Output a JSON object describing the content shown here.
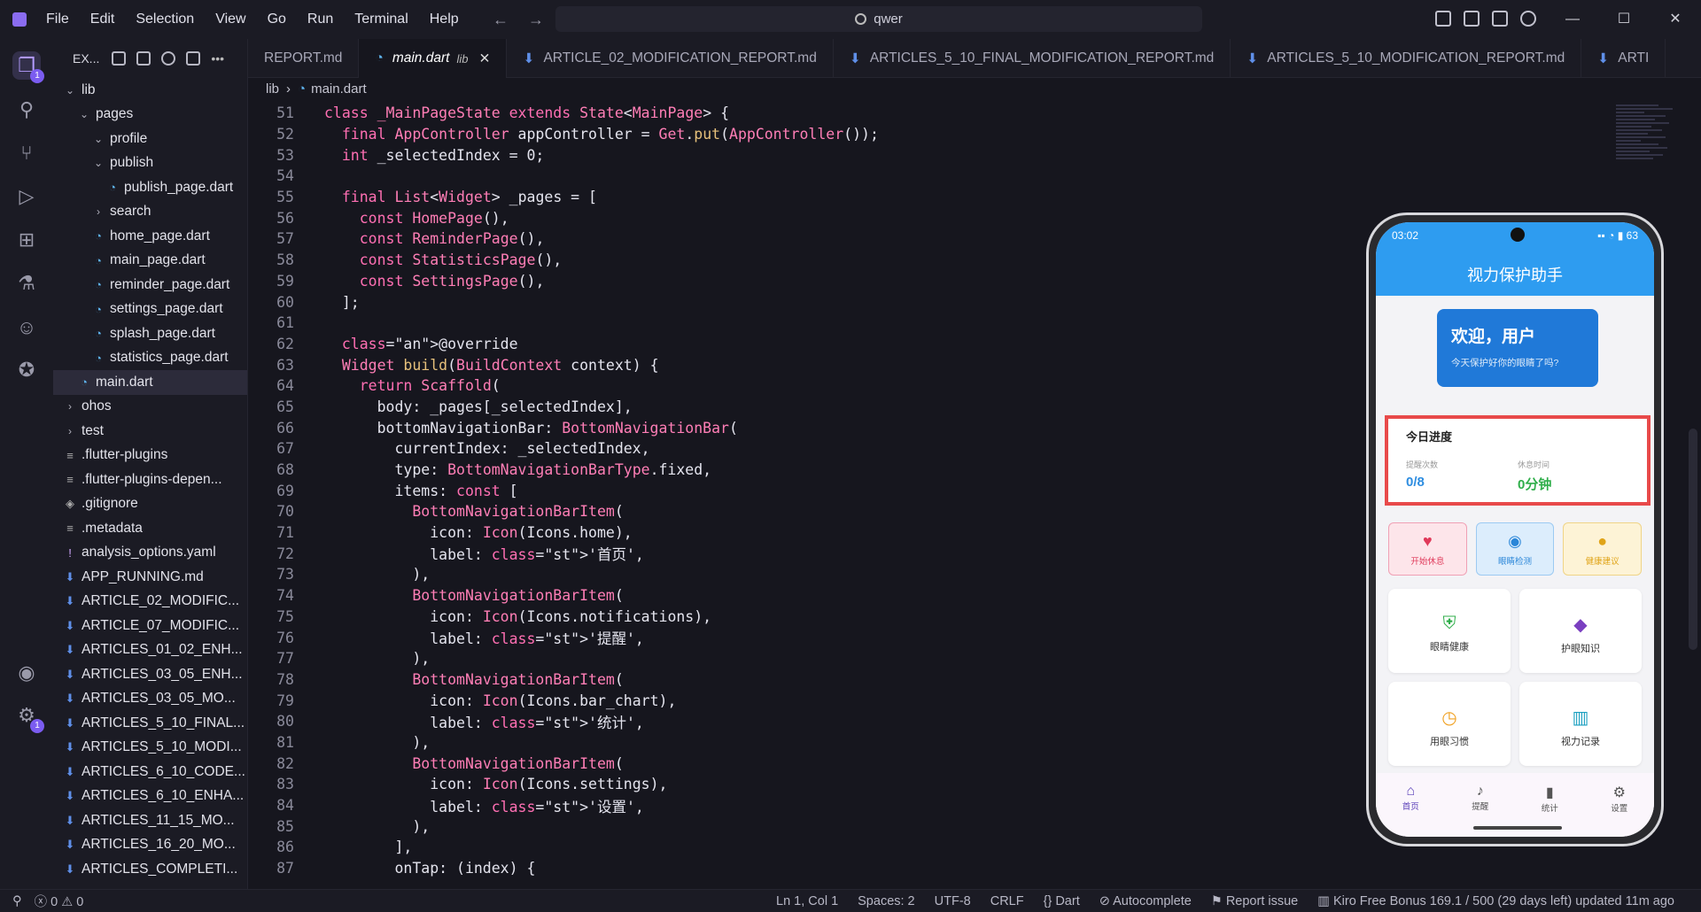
{
  "menu": [
    "File",
    "Edit",
    "Selection",
    "View",
    "Go",
    "Run",
    "Terminal",
    "Help"
  ],
  "search": {
    "text": "qwer"
  },
  "sidebar": {
    "title": "EX...",
    "items": [
      {
        "label": "lib",
        "indent": 1,
        "kind": "folder-open"
      },
      {
        "label": "pages",
        "indent": 2,
        "kind": "folder-open"
      },
      {
        "label": "profile",
        "indent": 3,
        "kind": "folder-open"
      },
      {
        "label": "publish",
        "indent": 3,
        "kind": "folder-open"
      },
      {
        "label": "publish_page.dart",
        "indent": 4,
        "kind": "dart"
      },
      {
        "label": "search",
        "indent": 3,
        "kind": "folder"
      },
      {
        "label": "home_page.dart",
        "indent": 3,
        "kind": "dart"
      },
      {
        "label": "main_page.dart",
        "indent": 3,
        "kind": "dart"
      },
      {
        "label": "reminder_page.dart",
        "indent": 3,
        "kind": "dart"
      },
      {
        "label": "settings_page.dart",
        "indent": 3,
        "kind": "dart"
      },
      {
        "label": "splash_page.dart",
        "indent": 3,
        "kind": "dart"
      },
      {
        "label": "statistics_page.dart",
        "indent": 3,
        "kind": "dart"
      },
      {
        "label": "main.dart",
        "indent": 2,
        "kind": "dart",
        "selected": true
      },
      {
        "label": "ohos",
        "indent": 1,
        "kind": "folder"
      },
      {
        "label": "test",
        "indent": 1,
        "kind": "folder"
      },
      {
        "label": ".flutter-plugins",
        "indent": 1,
        "kind": "gen"
      },
      {
        "label": ".flutter-plugins-depen...",
        "indent": 1,
        "kind": "gen"
      },
      {
        "label": ".gitignore",
        "indent": 1,
        "kind": "git"
      },
      {
        "label": ".metadata",
        "indent": 1,
        "kind": "gen"
      },
      {
        "label": "analysis_options.yaml",
        "indent": 1,
        "kind": "yaml"
      },
      {
        "label": "APP_RUNNING.md",
        "indent": 1,
        "kind": "md"
      },
      {
        "label": "ARTICLE_02_MODIFIC...",
        "indent": 1,
        "kind": "md"
      },
      {
        "label": "ARTICLE_07_MODIFIC...",
        "indent": 1,
        "kind": "md"
      },
      {
        "label": "ARTICLES_01_02_ENH...",
        "indent": 1,
        "kind": "md"
      },
      {
        "label": "ARTICLES_03_05_ENH...",
        "indent": 1,
        "kind": "md"
      },
      {
        "label": "ARTICLES_03_05_MO...",
        "indent": 1,
        "kind": "md"
      },
      {
        "label": "ARTICLES_5_10_FINAL...",
        "indent": 1,
        "kind": "md"
      },
      {
        "label": "ARTICLES_5_10_MODI...",
        "indent": 1,
        "kind": "md"
      },
      {
        "label": "ARTICLES_6_10_CODE...",
        "indent": 1,
        "kind": "md"
      },
      {
        "label": "ARTICLES_6_10_ENHA...",
        "indent": 1,
        "kind": "md"
      },
      {
        "label": "ARTICLES_11_15_MO...",
        "indent": 1,
        "kind": "md"
      },
      {
        "label": "ARTICLES_16_20_MO...",
        "indent": 1,
        "kind": "md"
      },
      {
        "label": "ARTICLES_COMPLETI...",
        "indent": 1,
        "kind": "md"
      }
    ]
  },
  "tabs": [
    {
      "label": "REPORT.md",
      "icon": "",
      "active": false
    },
    {
      "label": "main.dart",
      "suffix": "lib",
      "icon": "dart",
      "active": true
    },
    {
      "label": "ARTICLE_02_MODIFICATION_REPORT.md",
      "icon": "md",
      "active": false
    },
    {
      "label": "ARTICLES_5_10_FINAL_MODIFICATION_REPORT.md",
      "icon": "md",
      "active": false
    },
    {
      "label": "ARTICLES_5_10_MODIFICATION_REPORT.md",
      "icon": "md",
      "active": false
    },
    {
      "label": "ARTI",
      "icon": "md",
      "active": false
    }
  ],
  "breadcrumb": [
    "lib",
    "main.dart"
  ],
  "code_lines": [
    {
      "n": 51,
      "t": "class _MainPageState extends State<MainPage> {"
    },
    {
      "n": 52,
      "t": "  final AppController appController = Get.put(AppController());"
    },
    {
      "n": 53,
      "t": "  int _selectedIndex = 0;"
    },
    {
      "n": 54,
      "t": ""
    },
    {
      "n": 55,
      "t": "  final List<Widget> _pages = ["
    },
    {
      "n": 56,
      "t": "    const HomePage(),"
    },
    {
      "n": 57,
      "t": "    const ReminderPage(),"
    },
    {
      "n": 58,
      "t": "    const StatisticsPage(),"
    },
    {
      "n": 59,
      "t": "    const SettingsPage(),"
    },
    {
      "n": 60,
      "t": "  ];"
    },
    {
      "n": 61,
      "t": ""
    },
    {
      "n": 62,
      "t": "  @override"
    },
    {
      "n": 63,
      "t": "  Widget build(BuildContext context) {"
    },
    {
      "n": 64,
      "t": "    return Scaffold("
    },
    {
      "n": 65,
      "t": "      body: _pages[_selectedIndex],"
    },
    {
      "n": 66,
      "t": "      bottomNavigationBar: BottomNavigationBar("
    },
    {
      "n": 67,
      "t": "        currentIndex: _selectedIndex,"
    },
    {
      "n": 68,
      "t": "        type: BottomNavigationBarType.fixed,"
    },
    {
      "n": 69,
      "t": "        items: const ["
    },
    {
      "n": 70,
      "t": "          BottomNavigationBarItem("
    },
    {
      "n": 71,
      "t": "            icon: Icon(Icons.home),"
    },
    {
      "n": 72,
      "t": "            label: '首页',"
    },
    {
      "n": 73,
      "t": "          ),"
    },
    {
      "n": 74,
      "t": "          BottomNavigationBarItem("
    },
    {
      "n": 75,
      "t": "            icon: Icon(Icons.notifications),"
    },
    {
      "n": 76,
      "t": "            label: '提醒',"
    },
    {
      "n": 77,
      "t": "          ),"
    },
    {
      "n": 78,
      "t": "          BottomNavigationBarItem("
    },
    {
      "n": 79,
      "t": "            icon: Icon(Icons.bar_chart),"
    },
    {
      "n": 80,
      "t": "            label: '统计',"
    },
    {
      "n": 81,
      "t": "          ),"
    },
    {
      "n": 82,
      "t": "          BottomNavigationBarItem("
    },
    {
      "n": 83,
      "t": "            icon: Icon(Icons.settings),"
    },
    {
      "n": 84,
      "t": "            label: '设置',"
    },
    {
      "n": 85,
      "t": "          ),"
    },
    {
      "n": 86,
      "t": "        ],"
    },
    {
      "n": 87,
      "t": "        onTap: (index) {"
    }
  ],
  "phone": {
    "time": "03:02",
    "battery": "63",
    "app_title": "视力保护助手",
    "welcome_title": "欢迎，用户",
    "welcome_sub": "今天保护好你的眼睛了吗?",
    "progress_title": "今日进度",
    "progress": [
      {
        "label": "提醒次数",
        "value": "0/8"
      },
      {
        "label": "休息时间",
        "value": "0分钟"
      }
    ],
    "quick_actions": [
      "开始休息",
      "眼睛检测",
      "健康建议"
    ],
    "cards": [
      "眼睛健康",
      "护眼知识",
      "用眼习惯",
      "视力记录"
    ],
    "nav": [
      "首页",
      "提醒",
      "统计",
      "设置"
    ]
  },
  "statusbar": {
    "errors": "0",
    "warnings": "0",
    "position": "Ln 1, Col 1",
    "spaces": "Spaces: 2",
    "encoding": "UTF-8",
    "eol": "CRLF",
    "language": "Dart",
    "autocomplete": "Autocomplete",
    "report": "Report issue",
    "bonus": "Kiro Free Bonus 169.1 / 500 (29 days left) updated 11m ago"
  },
  "colors": {
    "accent": "#8a6cf0",
    "app_blue": "#2e9cf0",
    "highlight_box": "#e84a4a"
  }
}
